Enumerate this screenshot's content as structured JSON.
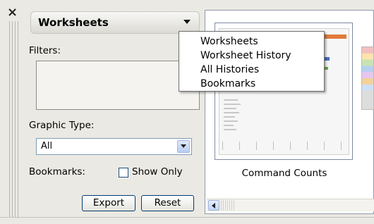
{
  "panel": {
    "close_glyph": "×",
    "selector_label": "Worksheets",
    "filters_label": "Filters:",
    "graphic_type_label": "Graphic Type:",
    "graphic_type_value": "All",
    "bookmarks_label": "Bookmarks:",
    "show_only_label": "Show Only",
    "show_only_checked": false,
    "export_label": "Export",
    "reset_label": "Reset"
  },
  "dropdown_menu": {
    "items": [
      "Worksheets",
      "Worksheet History",
      "All Histories",
      "Bookmarks"
    ]
  },
  "gallery": {
    "thumbnail_caption": "Command Counts"
  },
  "icons": {
    "close": "close-icon",
    "selector_arrow": "chevron-down-icon",
    "select_arrow": "chevron-down-icon",
    "scroll_left": "arrow-left-icon",
    "grip": "grip-icon"
  },
  "colors": {
    "panel_background": "#ebe9e3",
    "input_border": "#7f9db9",
    "button_border": "#003c74",
    "menu_border": "#6d6d6d"
  }
}
